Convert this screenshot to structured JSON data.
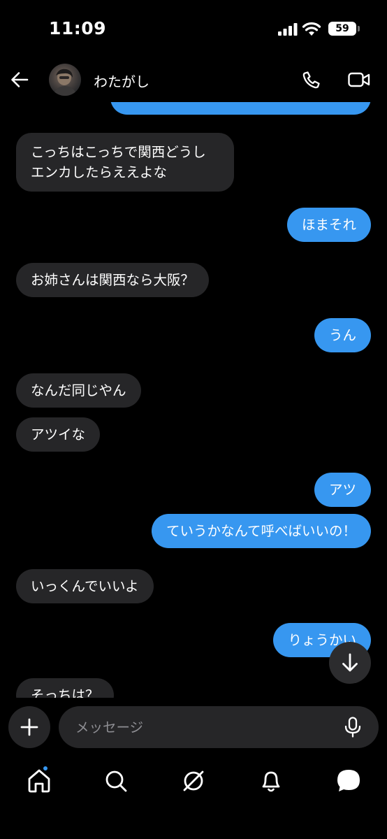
{
  "status": {
    "time": "11:09",
    "battery": "59"
  },
  "header": {
    "contact_name": "わたがし"
  },
  "messages": [
    {
      "dir": "out",
      "text": ""
    },
    {
      "dir": "in",
      "text": "こっちはこっちで関西どうしエンカしたらええよな"
    },
    {
      "dir": "out",
      "text": "ほまそれ"
    },
    {
      "dir": "in",
      "text": "お姉さんは関西なら大阪？"
    },
    {
      "dir": "out",
      "text": "うん"
    },
    {
      "dir": "in",
      "text": "なんだ同じやん"
    },
    {
      "dir": "in",
      "text": "アツイな"
    },
    {
      "dir": "out",
      "text": "アツ"
    },
    {
      "dir": "out",
      "text": "ていうかなんて呼べばいいの！"
    },
    {
      "dir": "in",
      "text": "いっくんでいいよ"
    },
    {
      "dir": "out",
      "text": "りょうかい"
    },
    {
      "dir": "in",
      "text": "そっちは？"
    }
  ],
  "composer": {
    "placeholder": "メッセージ"
  },
  "icons": {
    "back": "arrow-left-icon",
    "call": "phone-icon",
    "video": "video-camera-icon",
    "scroll": "arrow-down-icon",
    "add": "plus-icon",
    "mic": "microphone-icon",
    "nav": [
      "home-icon",
      "search-icon",
      "explore-icon",
      "bell-icon",
      "messages-icon"
    ]
  },
  "colors": {
    "outgoing": "#3797f0",
    "incoming": "#262628",
    "background": "#000000",
    "notification_dot": "#3797f0"
  }
}
